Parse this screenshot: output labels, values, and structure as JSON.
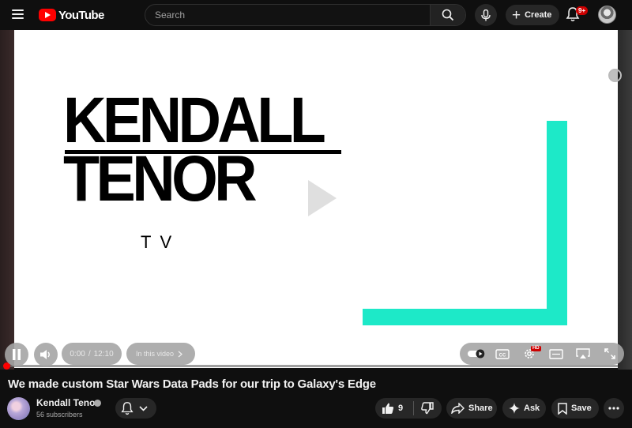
{
  "header": {
    "logo_text": "YouTube",
    "search_placeholder": "Search",
    "create_label": "Create",
    "notification_badge": "9+"
  },
  "video": {
    "frame_text_line1": "KENDALL",
    "frame_text_line2": "TENOR",
    "frame_text_sub": "TV",
    "accent_color": "#1de9c8",
    "progress_fraction": 0.0
  },
  "controls": {
    "time_current": "0:00",
    "time_separator": "/",
    "time_total": "12:10",
    "chapter_label": "In this video",
    "quality_badge": "HD",
    "icons": [
      "pause-icon",
      "volume-icon",
      "autoplay-toggle-icon",
      "captions-icon",
      "settings-icon",
      "miniplayer-icon",
      "cast-icon",
      "fullscreen-icon"
    ]
  },
  "details": {
    "title": "We made custom Star Wars Data Pads for our trip to Galaxy's Edge",
    "channel_name": "Kendall Tenor",
    "subscribers": "56 subscribers",
    "like_count": "9",
    "share_label": "Share",
    "ask_label": "Ask",
    "save_label": "Save"
  }
}
